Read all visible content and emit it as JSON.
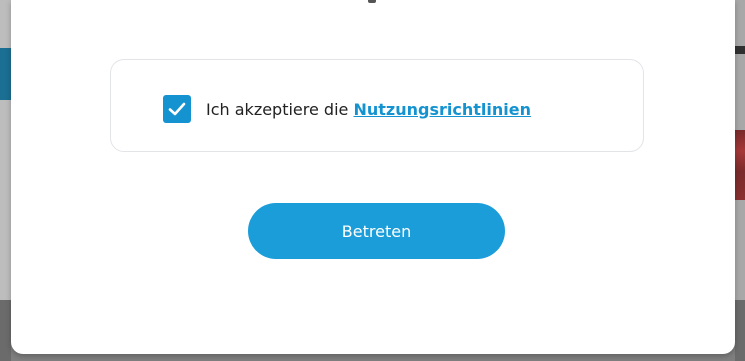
{
  "terms": {
    "checked": true,
    "prefix_text": "Ich akzeptiere die",
    "link_text": "Nutzungsrichtlinien"
  },
  "actions": {
    "enter_label": "Betreten"
  },
  "colors": {
    "accent": "#1593d1",
    "button": "#1a9dd9"
  },
  "icons": {
    "checkbox": "checkmark-icon"
  }
}
